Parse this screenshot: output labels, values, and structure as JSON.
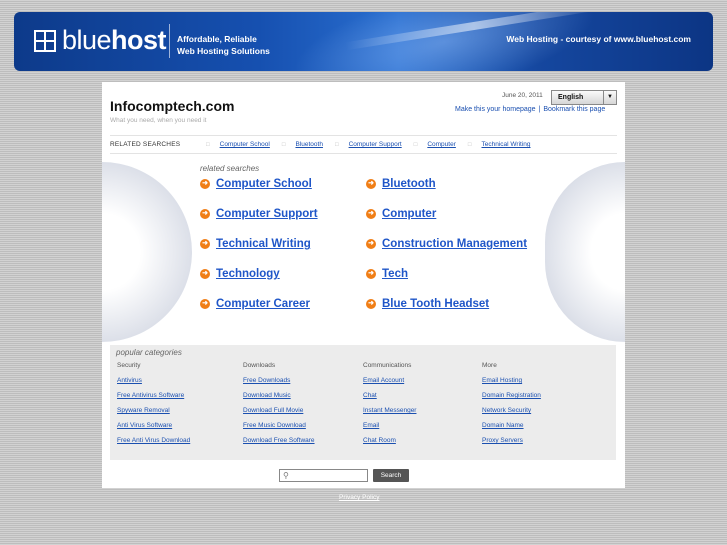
{
  "banner": {
    "logo_regular": "blue",
    "logo_bold": "host",
    "tagline_line1": "Affordable, Reliable",
    "tagline_line2": "Web Hosting Solutions",
    "courtesy": "Web Hosting - courtesy of www.bluehost.com"
  },
  "header": {
    "site_title": "Infocomptech.com",
    "site_subtitle": "What you need, when you need it",
    "date": "June 20, 2011",
    "language": "English",
    "make_homepage": "Make this your homepage",
    "separator": "|",
    "bookmark": "Bookmark this page"
  },
  "related_bar": {
    "label": "RELATED SEARCHES",
    "items": [
      "Computer School",
      "Bluetooth",
      "Computer Support",
      "Computer",
      "Technical Writing"
    ]
  },
  "related_searches": {
    "label": "related searches",
    "items": [
      "Computer School",
      "Bluetooth",
      "Computer Support",
      "Computer",
      "Technical Writing",
      "Construction Management",
      "Technology",
      "Tech",
      "Computer Career",
      "Blue Tooth Headset"
    ]
  },
  "popular": {
    "title": "popular categories",
    "columns": [
      {
        "head": "Security",
        "links": [
          "Antivirus",
          "Free Antivirus Software",
          "Spyware Removal",
          "Anti Virus Software",
          "Free Anti Virus Download"
        ]
      },
      {
        "head": "Downloads",
        "links": [
          "Free Downloads",
          "Download Music",
          "Download Full Movie",
          "Free Music Download",
          "Download Free Software"
        ]
      },
      {
        "head": "Communications",
        "links": [
          "Email Account",
          "Chat",
          "Instant Messenger",
          "Email",
          "Chat Room"
        ]
      },
      {
        "head": "More",
        "links": [
          "Email Hosting",
          "Domain Registration",
          "Network Security",
          "Domain Name",
          "Proxy Servers"
        ]
      }
    ]
  },
  "search": {
    "button": "Search",
    "value": ""
  },
  "footer": {
    "privacy": "Privacy Policy"
  },
  "colors": {
    "banner": "#1650b0",
    "link": "#1f56c8",
    "bullet": "#f07e16"
  },
  "icons": {
    "search": "magnifier-icon",
    "bullet": "arrow-circle-icon",
    "dropdown": "chevron-down-icon"
  }
}
